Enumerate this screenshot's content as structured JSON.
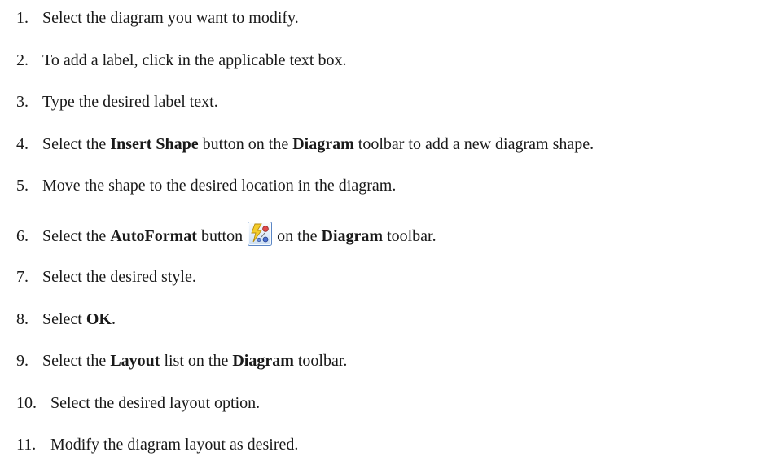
{
  "steps": [
    {
      "num": "1.",
      "text": "Select the diagram you want to modify."
    },
    {
      "num": "2.",
      "text": "To add a label, click in the applicable text box."
    },
    {
      "num": "3.",
      "text": "Type the desired label text."
    },
    {
      "num": "4.",
      "pre": "Select the ",
      "bold1": "Insert Shape",
      "mid": " button on the ",
      "bold2": "Diagram",
      "post": " toolbar to add a new diagram shape."
    },
    {
      "num": "5.",
      "text": "Move the shape to the desired location in the diagram."
    },
    {
      "num": "6.",
      "pre": "Select the ",
      "bold1": "AutoFormat",
      "mid": " button ",
      "mid2": " on the ",
      "bold2": "Diagram",
      "post": " toolbar.",
      "icon": "autoformat-icon"
    },
    {
      "num": "7.",
      "text": "Select the desired style."
    },
    {
      "num": "8.",
      "pre": "Select ",
      "bold1": "OK",
      "post": "."
    },
    {
      "num": "9.",
      "pre": "Select the ",
      "bold1": "Layout",
      "mid": " list on the ",
      "bold2": "Diagram",
      "post": " toolbar."
    },
    {
      "num": "10.",
      "text": "Select the desired layout option."
    },
    {
      "num": "11.",
      "text": "Modify the diagram layout as desired."
    }
  ]
}
